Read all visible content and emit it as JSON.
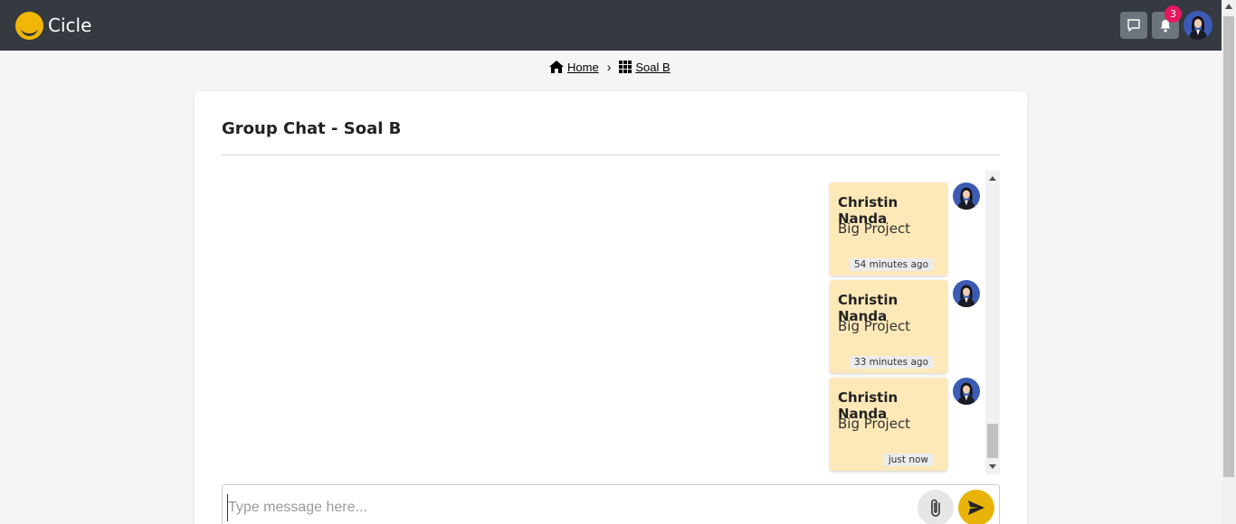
{
  "app": {
    "name": "Cicle"
  },
  "header": {
    "notification_count": "3"
  },
  "breadcrumb": {
    "home_label": "Home",
    "separator": "›",
    "current_label": "Soal B"
  },
  "card": {
    "title": "Group Chat - Soal B"
  },
  "messages": [
    {
      "sender": "Christin Nanda",
      "text": "Big Project",
      "time": "54 minutes ago"
    },
    {
      "sender": "Christin Nanda",
      "text": "Big Project",
      "time": "33 minutes ago"
    },
    {
      "sender": "Christin Nanda",
      "text": "Big Project",
      "time": "just now"
    }
  ],
  "composer": {
    "placeholder": "Type message here...",
    "value": ""
  },
  "colors": {
    "topbar": "#343a40",
    "accent": "#e9b307",
    "bubble": "#fde8b8",
    "badge": "#e8175d"
  },
  "icons": {
    "chat": "chat-bubble-icon",
    "bell": "bell-icon",
    "home": "home-icon",
    "grid": "grid-icon",
    "attach": "paperclip-icon",
    "send": "send-icon"
  }
}
